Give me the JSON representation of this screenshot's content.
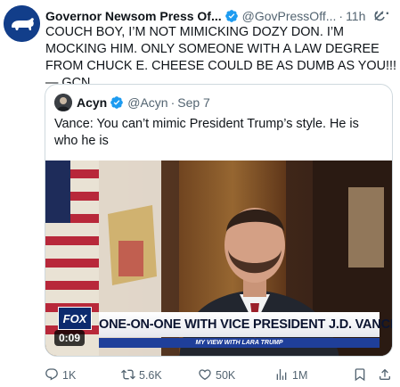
{
  "tweet": {
    "author_name": "Governor Newsom Press Of...",
    "handle": "@GovPressOff...",
    "separator": "·",
    "time": "11h",
    "more": "···",
    "text": "COUCH BOY, I’M NOT MIMICKING DOZY DON. I’M MOCKING HIM. ONLY SOMEONE WITH A LAW DEGREE FROM CHUCK E. CHEESE COULD BE AS DUMB AS YOU!!! — GCN"
  },
  "quote": {
    "author_name": "Acyn",
    "handle": "@Acyn",
    "separator": "·",
    "date": "Sep 7",
    "text": "Vance: You can’t mimic President Trump’s style. He is who he is",
    "video": {
      "duration": "0:09",
      "chyron_main": "ONE-ON-ONE WITH VICE PRESIDENT J.D. VANCE",
      "chyron_sub": "MY VIEW WITH LARA TRUMP",
      "network_logo": "FOX"
    }
  },
  "actions": {
    "replies": "1K",
    "reposts": "5.6K",
    "likes": "50K",
    "views": "1M"
  },
  "colors": {
    "verified": "#1d9bf0",
    "secondary_text": "#536471",
    "border": "#cfd9de",
    "avatar_bg": "#123e8a"
  },
  "icons": [
    "verified-badge-icon",
    "grok-icon",
    "more-icon",
    "reply-icon",
    "repost-icon",
    "like-icon",
    "views-icon",
    "bookmark-icon",
    "share-icon"
  ]
}
